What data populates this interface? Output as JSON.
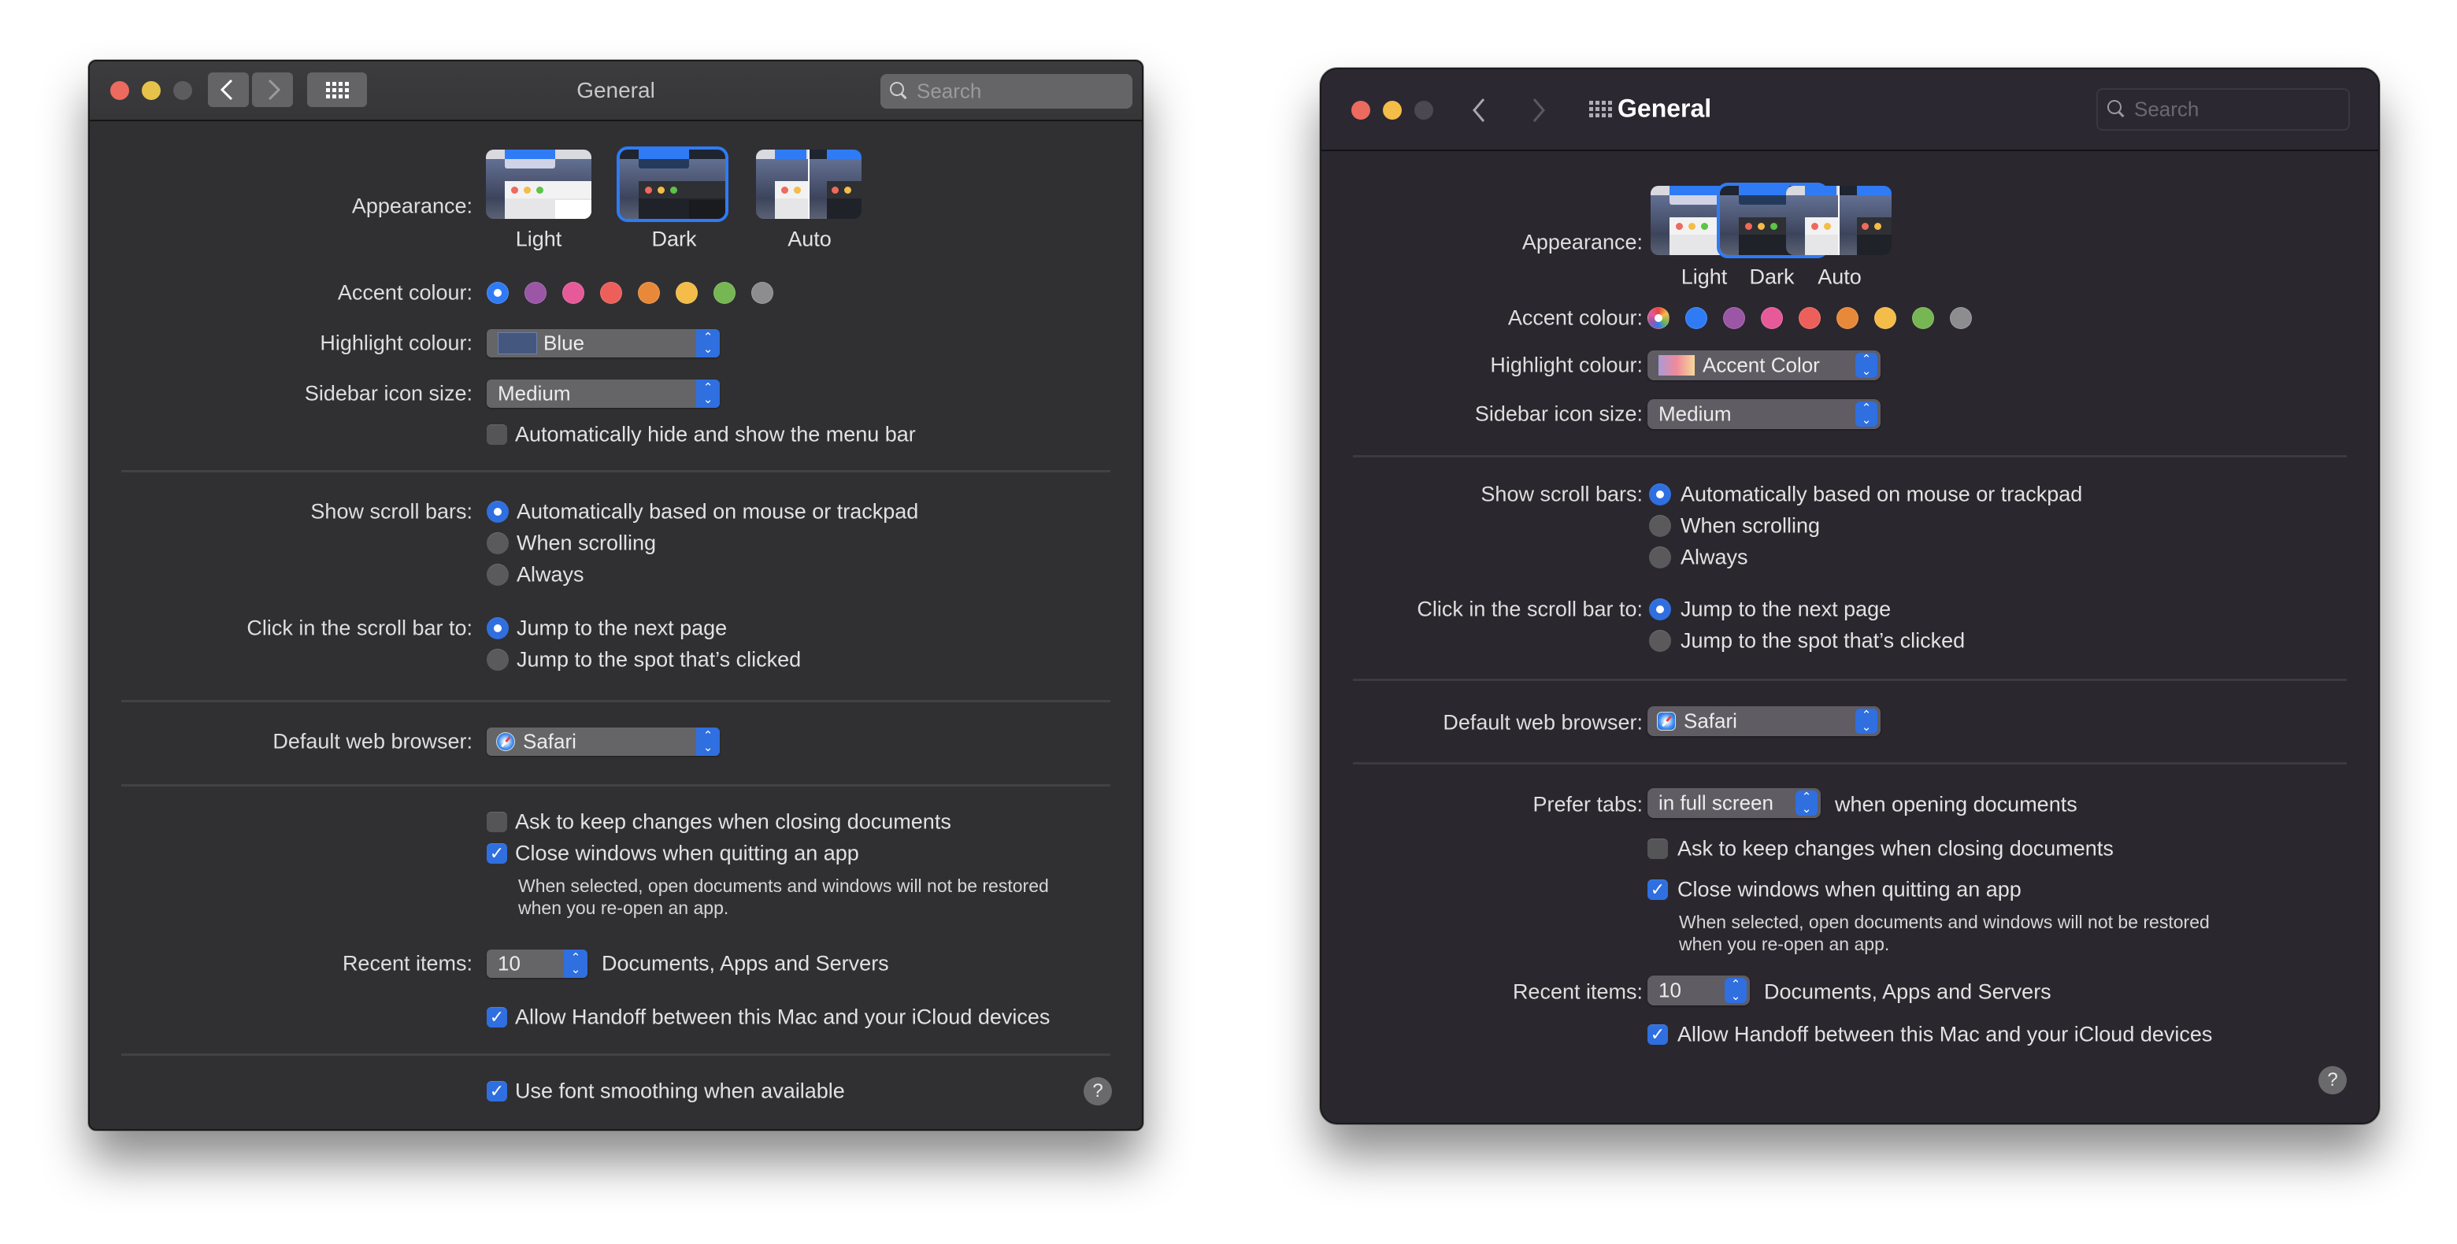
{
  "left": {
    "title": "General",
    "search_placeholder": "Search",
    "appearance": {
      "label": "Appearance:",
      "options": [
        {
          "label": "Light",
          "selected": false
        },
        {
          "label": "Dark",
          "selected": true
        },
        {
          "label": "Auto",
          "selected": false
        }
      ]
    },
    "accent": {
      "label": "Accent colour:",
      "colors": [
        {
          "name": "blue",
          "hex": "#2f7bf5",
          "selected": true
        },
        {
          "name": "purple",
          "hex": "#9b56a6"
        },
        {
          "name": "pink",
          "hex": "#e65a99"
        },
        {
          "name": "red",
          "hex": "#ec5f5b"
        },
        {
          "name": "orange",
          "hex": "#e8893a"
        },
        {
          "name": "yellow",
          "hex": "#f4bc48"
        },
        {
          "name": "green",
          "hex": "#76b653"
        },
        {
          "name": "graphite",
          "hex": "#8d8d8f"
        }
      ]
    },
    "highlight": {
      "label": "Highlight colour:",
      "value": "Blue",
      "chip": "#44577f"
    },
    "sidebar_icon_size": {
      "label": "Sidebar icon size:",
      "value": "Medium"
    },
    "auto_hide_menu_bar": {
      "label": "Automatically hide and show the menu bar",
      "checked": false
    },
    "show_scroll_bars": {
      "label": "Show scroll bars:",
      "options": [
        {
          "label": "Automatically based on mouse or trackpad",
          "selected": true
        },
        {
          "label": "When scrolling",
          "selected": false
        },
        {
          "label": "Always",
          "selected": false
        }
      ]
    },
    "click_scroll_bar": {
      "label": "Click in the scroll bar to:",
      "options": [
        {
          "label": "Jump to the next page",
          "selected": true
        },
        {
          "label": "Jump to the spot that’s clicked",
          "selected": false
        }
      ]
    },
    "default_browser": {
      "label": "Default web browser:",
      "value": "Safari"
    },
    "ask_keep_changes": {
      "label": "Ask to keep changes when closing documents",
      "checked": false
    },
    "close_windows": {
      "label": "Close windows when quitting an app",
      "checked": true
    },
    "close_windows_desc": [
      "When selected, open documents and windows will not be restored",
      "when you re-open an app."
    ],
    "recent_items": {
      "label": "Recent items:",
      "value": "10",
      "suffix": "Documents, Apps and Servers"
    },
    "handoff": {
      "label": "Allow Handoff between this Mac and your iCloud devices",
      "checked": true
    },
    "font_smoothing": {
      "label": "Use font smoothing when available",
      "checked": true
    },
    "help": "?"
  },
  "right": {
    "title": "General",
    "search_placeholder": "Search",
    "appearance": {
      "label": "Appearance:",
      "options": [
        {
          "label": "Light",
          "selected": false
        },
        {
          "label": "Dark",
          "selected": true
        },
        {
          "label": "Auto",
          "selected": false
        }
      ]
    },
    "accent": {
      "label": "Accent colour:",
      "colors": [
        {
          "name": "multicolor",
          "hex": "multicolor",
          "selected": true
        },
        {
          "name": "blue",
          "hex": "#2f7bf5"
        },
        {
          "name": "purple",
          "hex": "#9b56a6"
        },
        {
          "name": "pink",
          "hex": "#e65a99"
        },
        {
          "name": "red",
          "hex": "#ec5f5b"
        },
        {
          "name": "orange",
          "hex": "#e8893a"
        },
        {
          "name": "yellow",
          "hex": "#f4bc48"
        },
        {
          "name": "green",
          "hex": "#76b653"
        },
        {
          "name": "graphite",
          "hex": "#8d8d8f"
        }
      ]
    },
    "highlight": {
      "label": "Highlight colour:",
      "value": "Accent Color"
    },
    "sidebar_icon_size": {
      "label": "Sidebar icon size:",
      "value": "Medium"
    },
    "show_scroll_bars": {
      "label": "Show scroll bars:",
      "options": [
        {
          "label": "Automatically based on mouse or trackpad",
          "selected": true
        },
        {
          "label": "When scrolling",
          "selected": false
        },
        {
          "label": "Always",
          "selected": false
        }
      ]
    },
    "click_scroll_bar": {
      "label": "Click in the scroll bar to:",
      "options": [
        {
          "label": "Jump to the next page",
          "selected": true
        },
        {
          "label": "Jump to the spot that’s clicked",
          "selected": false
        }
      ]
    },
    "default_browser": {
      "label": "Default web browser:",
      "value": "Safari"
    },
    "prefer_tabs": {
      "label": "Prefer tabs:",
      "value": "in full screen",
      "suffix": "when opening documents"
    },
    "ask_keep_changes": {
      "label": "Ask to keep changes when closing documents",
      "checked": false
    },
    "close_windows": {
      "label": "Close windows when quitting an app",
      "checked": true
    },
    "close_windows_desc": [
      "When selected, open documents and windows will not be restored",
      "when you re-open an app."
    ],
    "recent_items": {
      "label": "Recent items:",
      "value": "10",
      "suffix": "Documents, Apps and Servers"
    },
    "handoff": {
      "label": "Allow Handoff between this Mac and your iCloud devices",
      "checked": true
    },
    "help": "?"
  },
  "icons": {
    "check": "✓",
    "stepper_up": "⌃",
    "stepper_down": "⌄",
    "back": "‹",
    "forward": "›"
  },
  "colors": {
    "accent_blue": "#2f6fe0",
    "close": "#ed6a5e",
    "minimize": "#e6c24a",
    "zoom_inactive": "#5c5c5e"
  }
}
